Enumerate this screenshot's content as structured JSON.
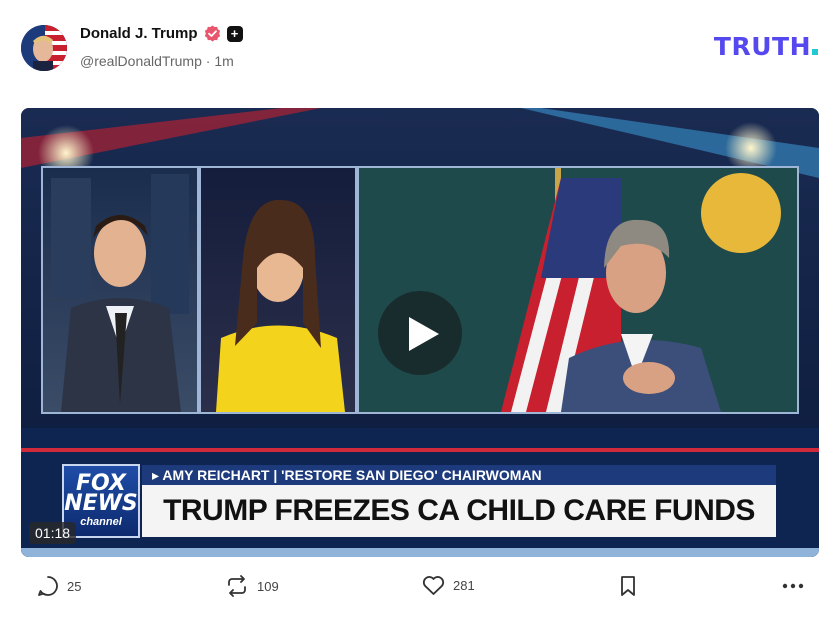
{
  "post": {
    "display_name": "Donald J. Trump",
    "handle": "@realDonaldTrump",
    "separator": "·",
    "time": "1m",
    "plus_badge": "+"
  },
  "brand": {
    "logo_text": "TRUTH",
    "colors": {
      "logo": "#5448ee",
      "logo_dot": "#22c8d4",
      "verified": "#e8556d"
    }
  },
  "video": {
    "duration": "01:18",
    "network_logo_top": "FOX",
    "network_logo_mid": "NEWS",
    "network_logo_bottom": "channel",
    "chyron_subtitle": "▸ AMY REICHART | 'RESTORE SAN DIEGO' CHAIRWOMAN",
    "chyron_headline": "TRUMP FREEZES CA CHILD CARE FUNDS"
  },
  "actions": {
    "replies": "25",
    "reposts": "109",
    "likes": "281",
    "icons": [
      "comment-icon",
      "repost-icon",
      "heart-icon",
      "bookmark-icon",
      "more-icon"
    ]
  }
}
